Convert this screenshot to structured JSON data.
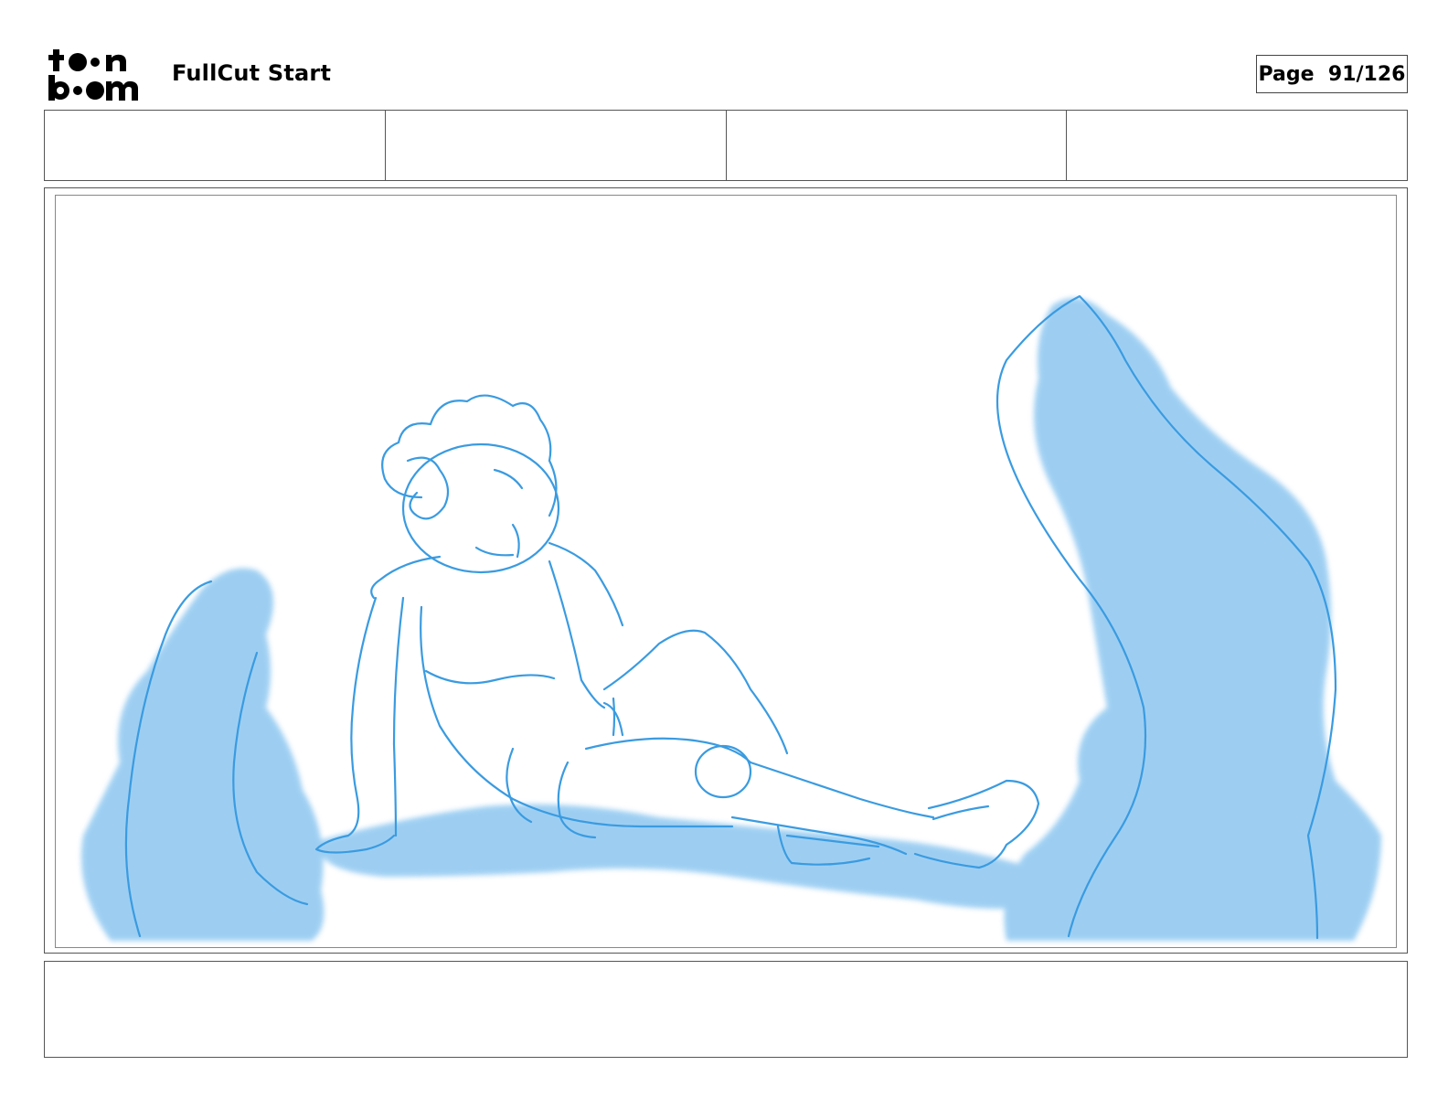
{
  "header": {
    "logo_text": "toon boom",
    "project_title": "FullCut Start",
    "page_label": "Page",
    "page_number": "91/126",
    "page_text": "Page  91/126"
  },
  "info_row": {
    "cells": [
      "",
      "",
      "",
      ""
    ]
  },
  "panel": {
    "description": "",
    "sketch_color": "#3a9be0",
    "fill_color": "#8cc6f0"
  },
  "notes": {
    "text": ""
  }
}
